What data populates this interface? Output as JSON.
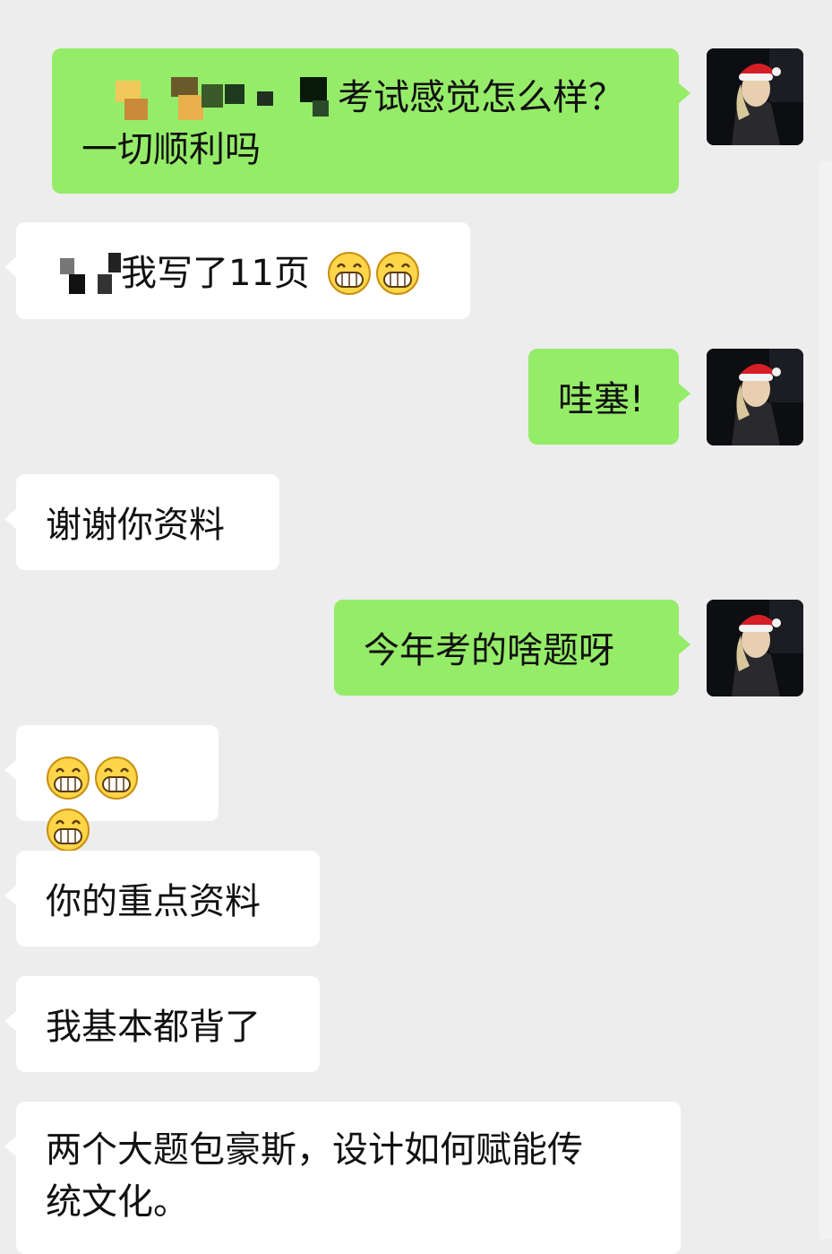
{
  "chat": {
    "messages": [
      {
        "id": 1,
        "sender": "me",
        "prefix_redacted": true,
        "text": "考试感觉怎么样？",
        "text2": "一切顺利吗"
      },
      {
        "id": 2,
        "sender": "other",
        "prefix_redacted": true,
        "text": "我写了11页",
        "emojis": [
          "grin-emoji",
          "grin-emoji"
        ]
      },
      {
        "id": 3,
        "sender": "me",
        "text": "哇塞!"
      },
      {
        "id": 4,
        "sender": "other",
        "text": "谢谢你资料"
      },
      {
        "id": 5,
        "sender": "me",
        "text": "今年考的啥题呀"
      },
      {
        "id": 6,
        "sender": "other",
        "emojis": [
          "grin-emoji",
          "grin-emoji",
          "grin-emoji"
        ]
      },
      {
        "id": 7,
        "sender": "other",
        "text": "你的重点资料"
      },
      {
        "id": 8,
        "sender": "other",
        "text": "我基本都背了"
      },
      {
        "id": 9,
        "sender": "other",
        "text": "两个大题包豪斯，设计如何赋能传",
        "text2": "统文化。"
      }
    ]
  },
  "colors": {
    "background": "#ededed",
    "outgoing_bubble": "#95ec69",
    "incoming_bubble": "#ffffff"
  },
  "icons": {
    "avatar": "avatar-santa-hat",
    "emoji": "grin-emoji"
  }
}
